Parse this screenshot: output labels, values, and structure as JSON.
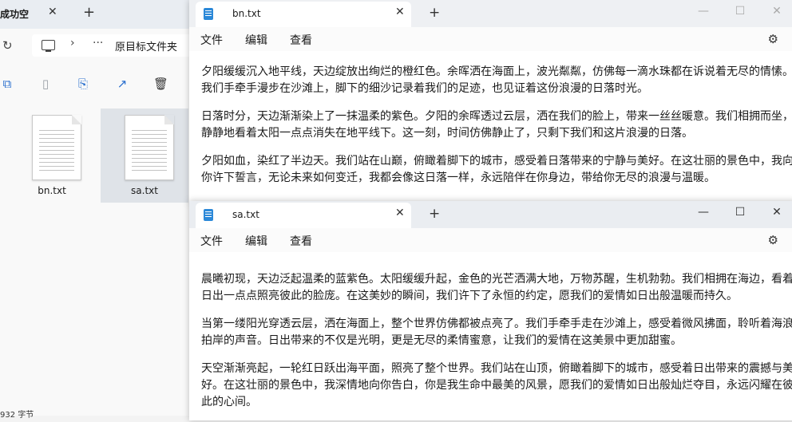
{
  "explorer": {
    "tab_title": "成功空",
    "tab_close": "✕",
    "new_tab": "+",
    "refresh": "↻",
    "path_arrow": "›",
    "path_dots": "···",
    "path_label": "原目标文件夹",
    "toolbar_icons": [
      "copy-icon",
      "paste-icon",
      "rename-icon",
      "share-icon",
      "delete-icon"
    ],
    "files": [
      {
        "name": "bn.txt",
        "selected": false
      },
      {
        "name": "sa.txt",
        "selected": true
      }
    ],
    "status": "932 字节"
  },
  "notepad_bn": {
    "tab_title": "bn.txt",
    "tab_close": "✕",
    "new_tab": "+",
    "win_min": "—",
    "win_max": "☐",
    "win_close": "✕",
    "menu": {
      "file": "文件",
      "edit": "编辑",
      "view": "查看"
    },
    "gear": "⚙",
    "paragraphs": [
      "夕阳缓缓沉入地平线，天边绽放出绚烂的橙红色。余晖洒在海面上，波光粼粼，仿佛每一滴水珠都在诉说着无尽的情愫。我们手牵手漫步在沙滩上，脚下的细沙记录着我们的足迹，也见证着这份浪漫的日落时光。",
      "日落时分，天边渐渐染上了一抹温柔的紫色。夕阳的余晖透过云层，洒在我们的脸上，带来一丝丝暖意。我们相拥而坐，静静地看着太阳一点点消失在地平线下。这一刻，时间仿佛静止了，只剩下我们和这片浪漫的日落。",
      "夕阳如血，染红了半边天。我们站在山巅，俯瞰着脚下的城市，感受着日落带来的宁静与美好。在这壮丽的景色中，我向你许下誓言，无论未来如何变迁，我都会像这日落一样，永远陪伴在你身边，带给你无尽的浪漫与温暖。"
    ]
  },
  "notepad_sa": {
    "tab_title": "sa.txt",
    "tab_close": "✕",
    "new_tab": "+",
    "win_min": "—",
    "win_max": "☐",
    "win_close": "✕",
    "menu": {
      "file": "文件",
      "edit": "编辑",
      "view": "查看"
    },
    "gear": "⚙",
    "paragraphs": [
      "晨曦初现，天边泛起温柔的蓝紫色。太阳缓缓升起，金色的光芒洒满大地，万物苏醒，生机勃勃。我们相拥在海边，看着日出一点点照亮彼此的脸庞。在这美妙的瞬间，我们许下了永恒的约定，愿我们的爱情如日出般温暖而持久。",
      "当第一缕阳光穿透云层，洒在海面上，整个世界仿佛都被点亮了。我们手牵手走在沙滩上，感受着微风拂面，聆听着海浪拍岸的声音。日出带来的不仅是光明，更是无尽的柔情蜜意，让我们的爱情在这美景中更加甜蜜。",
      "天空渐渐亮起，一轮红日跃出海平面，照亮了整个世界。我们站在山顶，俯瞰着脚下的城市，感受着日出带来的震撼与美好。在这壮丽的景色中，我深情地向你告白，你是我生命中最美的风景，愿我们的爱情如日出般灿烂夺目，永远闪耀在彼此的心间。"
    ]
  }
}
